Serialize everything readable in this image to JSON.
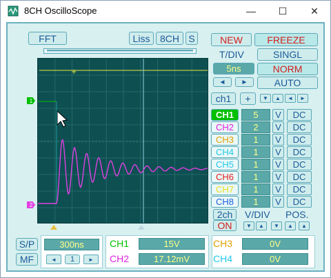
{
  "window": {
    "title": "8CH OscilloScope",
    "minimize_glyph": "—",
    "maximize_glyph": "☐",
    "close_glyph": "✕"
  },
  "top_left": {
    "fft": "FFT",
    "liss": "Liss",
    "ch8": "8CH",
    "s": "S"
  },
  "right_panel": {
    "new": "NEW",
    "freeze": "FREEZE",
    "tdiv_label": "T/DIV",
    "tdiv_value": "5ns",
    "singl": "SINGL",
    "norm": "NORM",
    "auto": "AUTO",
    "ch_select": "ch1",
    "plus": "+",
    "left_arrow": "◄",
    "right_arrow": "►"
  },
  "channels": [
    {
      "name": "CH1",
      "vdiv": "5",
      "unit": "V",
      "coupling": "DC",
      "color": "#00c000",
      "active": true
    },
    {
      "name": "CH2",
      "vdiv": "2",
      "unit": "V",
      "coupling": "DC",
      "color": "#e020e0",
      "active": false
    },
    {
      "name": "CH3",
      "vdiv": "1",
      "unit": "V",
      "coupling": "DC",
      "color": "#e0a000",
      "active": false
    },
    {
      "name": "CH4",
      "vdiv": "1",
      "unit": "V",
      "coupling": "DC",
      "color": "#20c8e8",
      "active": false
    },
    {
      "name": "CH5",
      "vdiv": "1",
      "unit": "V",
      "coupling": "DC",
      "color": "#20c8e8",
      "active": false
    },
    {
      "name": "CH6",
      "vdiv": "1",
      "unit": "V",
      "coupling": "DC",
      "color": "#e02020",
      "active": false
    },
    {
      "name": "CH7",
      "vdiv": "1",
      "unit": "V",
      "coupling": "DC",
      "color": "#e8e020",
      "active": false
    },
    {
      "name": "CH8",
      "vdiv": "1",
      "unit": "V",
      "coupling": "DC",
      "color": "#2060e0",
      "active": false
    }
  ],
  "bottom_right": {
    "two_ch": "2ch",
    "on": "ON",
    "vdiv_label": "V/DIV",
    "pos_label": "POS."
  },
  "bottom": {
    "sp": "S/P",
    "mf": "MF",
    "time_value": "300ns",
    "page_number": "1",
    "ch1_label": "CH1",
    "ch1_value": "15V",
    "ch2_label": "CH2",
    "ch2_value": "17.12mV",
    "ch3_label": "CH3",
    "ch3_value": "0V",
    "ch4_label": "CH4",
    "ch4_value": "0V"
  },
  "scope": {
    "ch1_marker": "1",
    "ch2_marker": "2",
    "trace_color": "#e040e0",
    "trigger_color": "#e8e840",
    "grid_color": "#2a7070"
  }
}
